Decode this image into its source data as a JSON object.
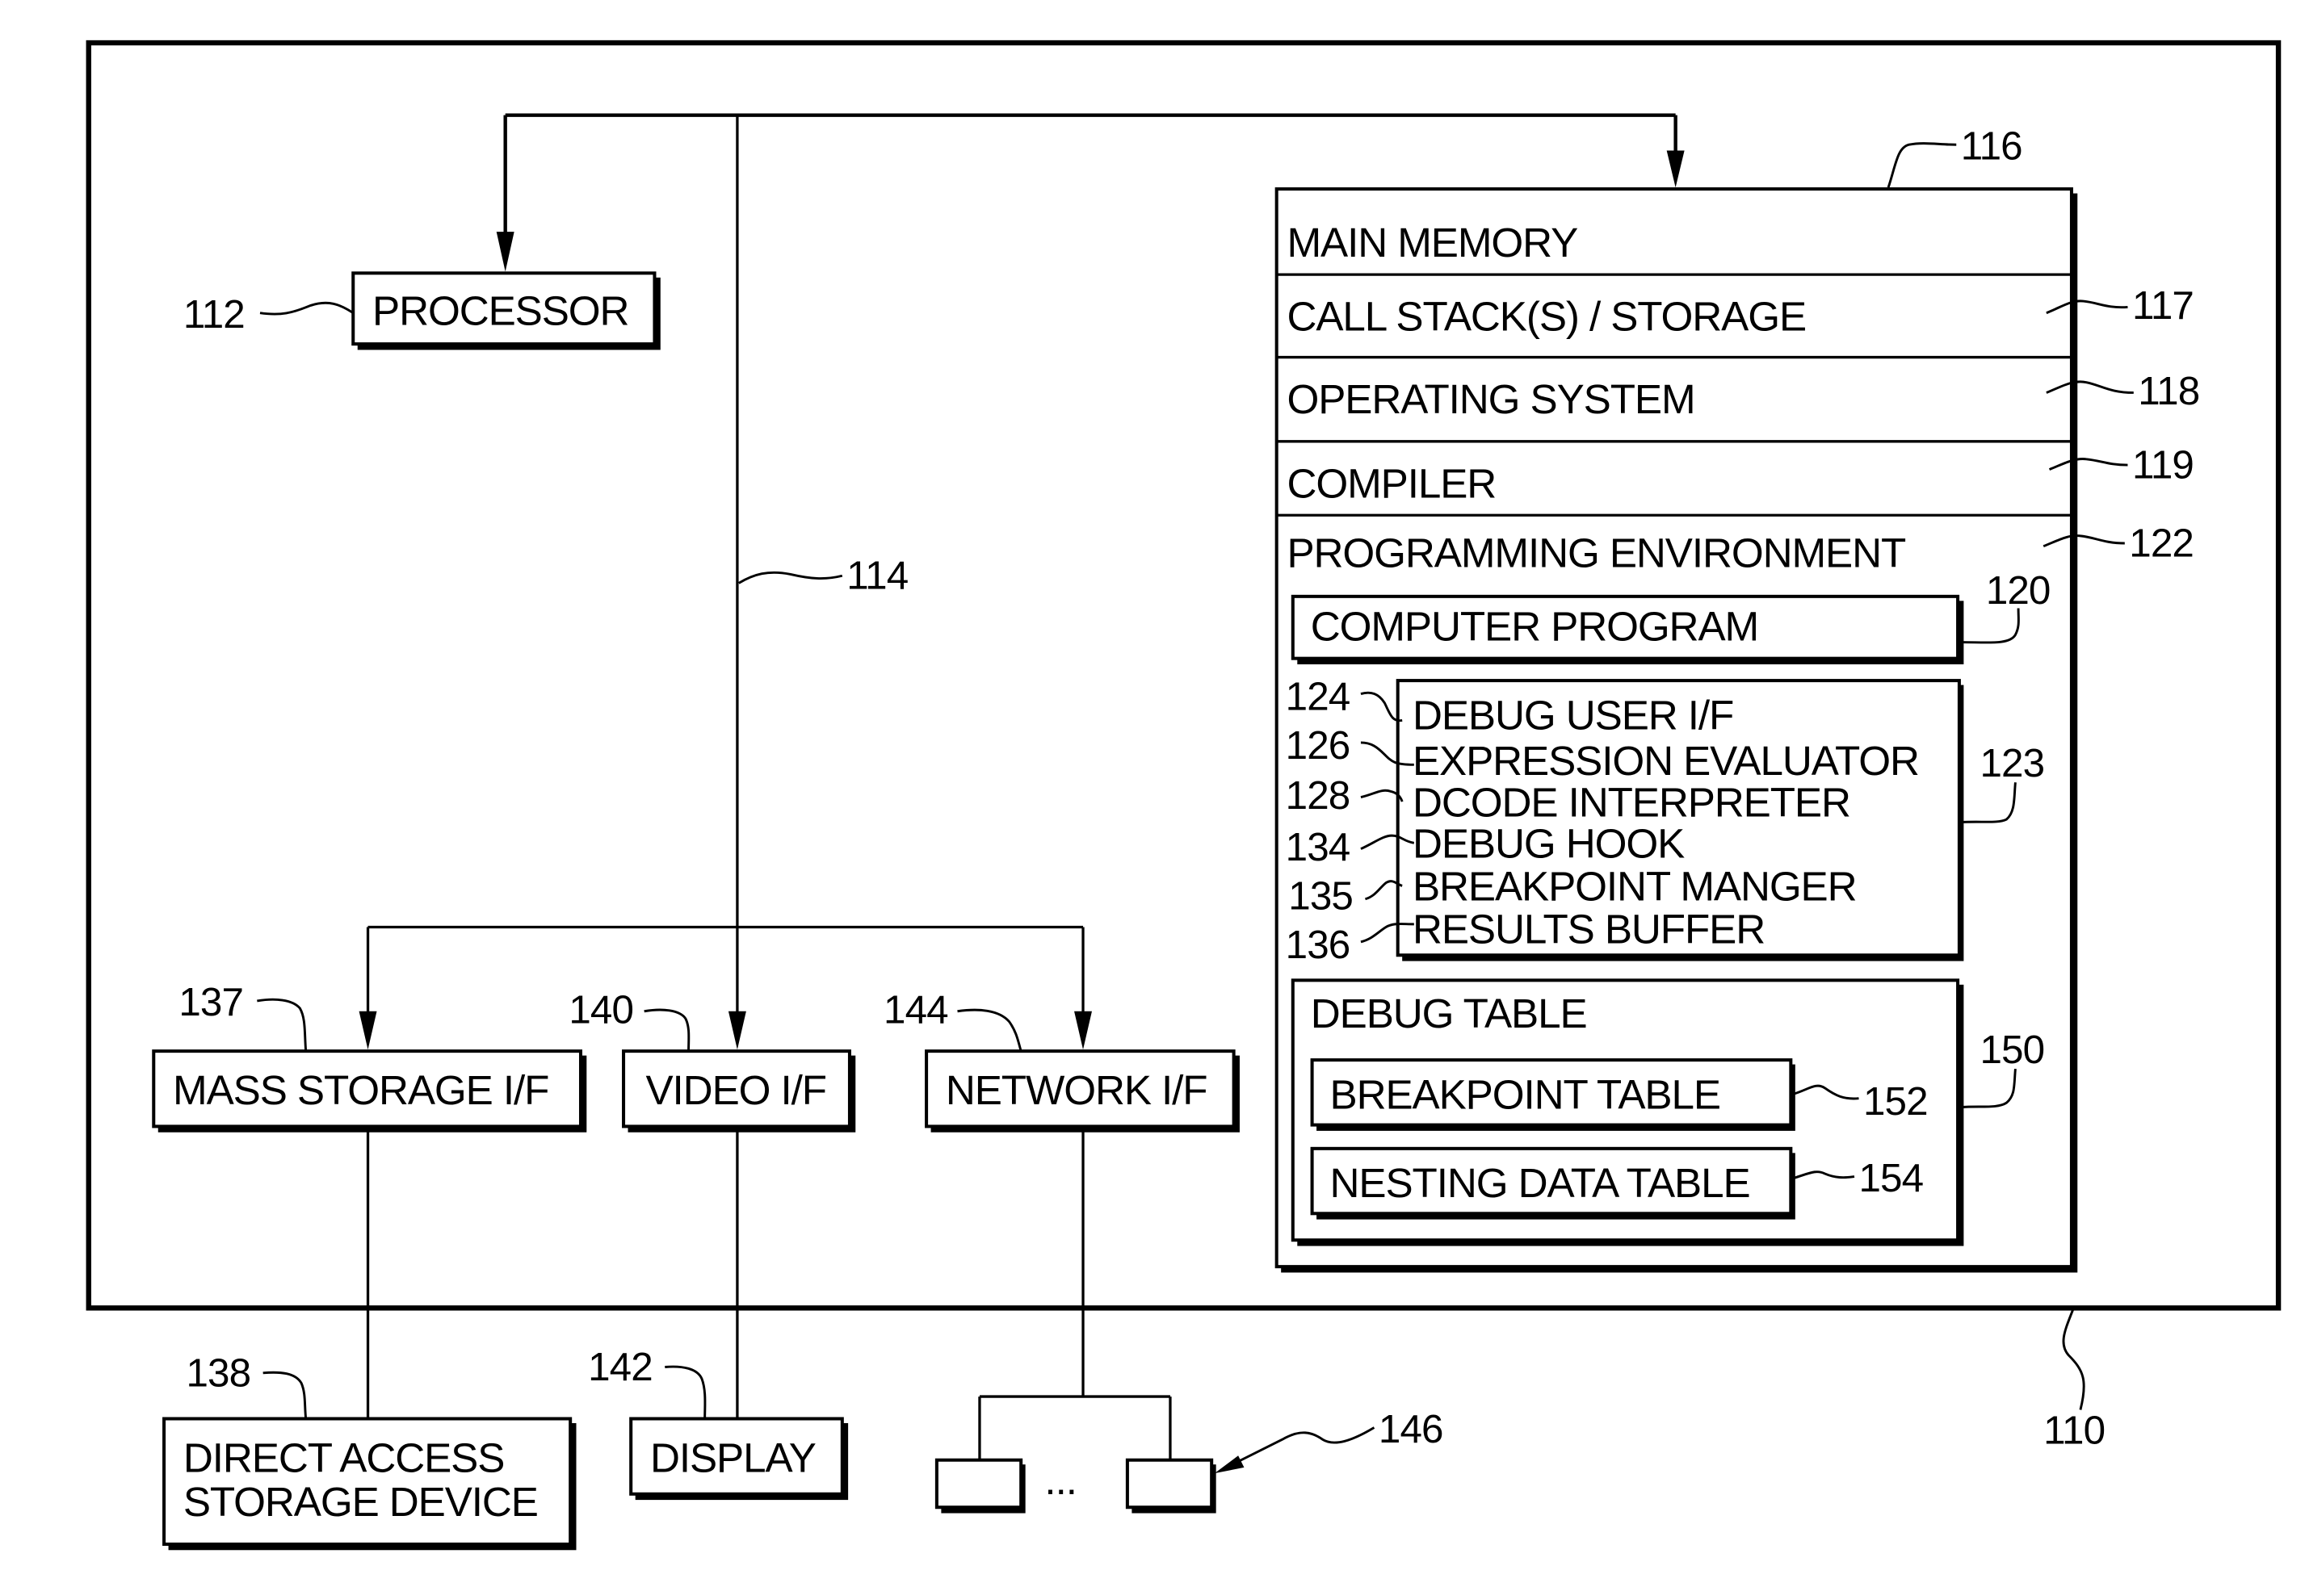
{
  "figure": {
    "system_ref": "110",
    "bus_ref": "114"
  },
  "processor": {
    "label": "PROCESSOR",
    "ref": "112"
  },
  "main_memory": {
    "ref": "116",
    "title": "MAIN MEMORY",
    "rows": [
      {
        "label": "CALL STACK(S) / STORAGE",
        "ref": "117"
      },
      {
        "label": "OPERATING SYSTEM",
        "ref": "118"
      },
      {
        "label": "COMPILER",
        "ref": "119"
      }
    ],
    "programming_environment": {
      "label": "PROGRAMMING ENVIRONMENT",
      "ref": "122",
      "computer_program": {
        "label": "COMPUTER PROGRAM",
        "ref": "120"
      },
      "debugger": {
        "ref": "123",
        "items": [
          {
            "label": "DEBUG USER I/F",
            "ref": "124"
          },
          {
            "label": "EXPRESSION EVALUATOR",
            "ref": "126"
          },
          {
            "label": "DCODE INTERPRETER",
            "ref": "128"
          },
          {
            "label": "DEBUG HOOK",
            "ref": "134"
          },
          {
            "label": "BREAKPOINT MANGER",
            "ref": "135"
          },
          {
            "label": "RESULTS BUFFER",
            "ref": "136"
          }
        ]
      },
      "debug_table": {
        "label": "DEBUG TABLE",
        "ref": "150",
        "tables": [
          {
            "label": "BREAKPOINT TABLE",
            "ref": "152"
          },
          {
            "label": "NESTING DATA TABLE",
            "ref": "154"
          }
        ]
      }
    }
  },
  "interfaces": [
    {
      "label": "MASS STORAGE I/F",
      "ref": "137"
    },
    {
      "label": "VIDEO I/F",
      "ref": "140"
    },
    {
      "label": "NETWORK I/F",
      "ref": "144"
    }
  ],
  "external": {
    "dasd": {
      "line1": "DIRECT ACCESS",
      "line2": "STORAGE DEVICE",
      "ref": "138"
    },
    "display": {
      "label": "DISPLAY",
      "ref": "142"
    },
    "network_nodes": {
      "ellipsis": "...",
      "ref": "146"
    }
  }
}
